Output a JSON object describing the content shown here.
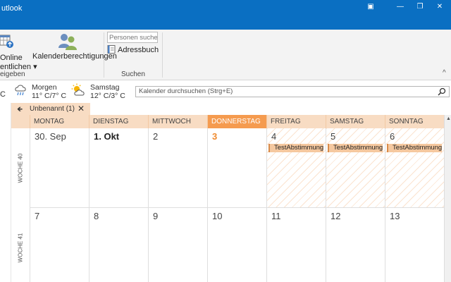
{
  "window": {
    "title": "utlook",
    "special_icon": "▣",
    "minimize": "—",
    "maximize": "❐",
    "close": "✕"
  },
  "ribbon": {
    "publish": {
      "line1": "Online",
      "line2": "entlichen ▾",
      "icon": "calendar-publish-icon"
    },
    "permissions": {
      "label": "Kalenderberechtigungen",
      "icon": "people-icon"
    },
    "share_group_label": "eigeben",
    "search_people_placeholder": "Personen suchen",
    "addressbook_label": "Adressbuch",
    "search_group_label": "Suchen",
    "collapse_label": "^"
  },
  "weather": {
    "current_temp": "C",
    "tomorrow": {
      "day": "Morgen",
      "temp": "11° C/7° C",
      "icon": "rain-cloud-icon"
    },
    "saturday": {
      "day": "Samstag",
      "temp": "12° C/3° C",
      "icon": "sun-cloud-icon"
    },
    "search_placeholder": "Kalender durchsuchen (Strg+E)"
  },
  "tab": {
    "label": "Unbenannt (1)",
    "back": "🡸",
    "close": "✕"
  },
  "calendar": {
    "days": [
      "MONTAG",
      "DIENSTAG",
      "MITTWOCH",
      "DONNERSTAG",
      "FREITAG",
      "SAMSTAG",
      "SONNTAG"
    ],
    "today_index": 3,
    "weeks": [
      {
        "label": "WOCHE 40",
        "dates": [
          "30. Sep",
          "1. Okt",
          "2",
          "3",
          "4",
          "5",
          "6"
        ],
        "appointments": [
          null,
          null,
          null,
          null,
          "TestAbstimmung",
          "TestAbstimmung",
          "TestAbstimmung"
        ]
      },
      {
        "label": "WOCHE 41",
        "dates": [
          "7",
          "8",
          "9",
          "10",
          "11",
          "12",
          "13"
        ],
        "appointments": [
          null,
          null,
          null,
          null,
          null,
          null,
          null
        ]
      }
    ],
    "colors": {
      "header": "#f8dcc3",
      "today": "#f59b4f",
      "appointment": "#f5c89f"
    }
  }
}
